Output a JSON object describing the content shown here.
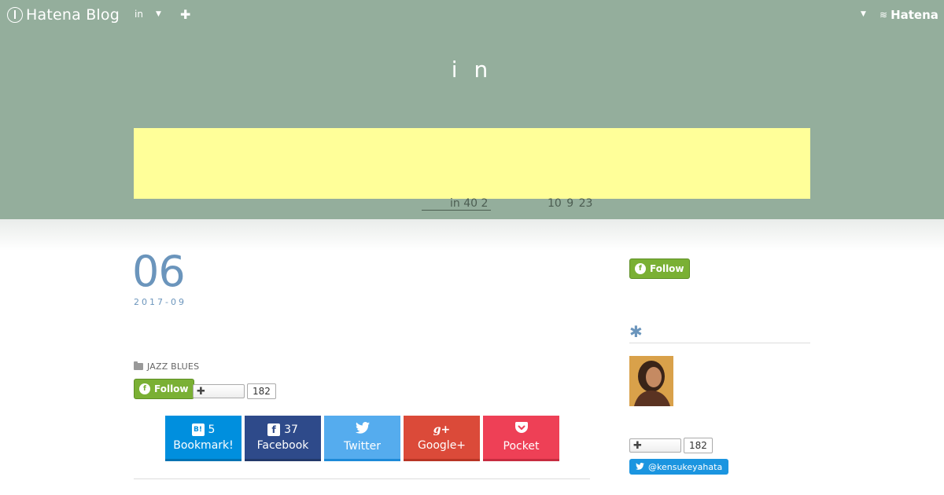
{
  "topbar": {
    "logo_text": "Hatena Blog",
    "blog_selector": "in",
    "brand": "Hatena"
  },
  "blog": {
    "title": "i n",
    "banner_note_left": "in  40 2",
    "banner_note_right": "10  9  23"
  },
  "post": {
    "day": "06",
    "year_month": "2017-09",
    "category": "JAZZ BLUES"
  },
  "follow": {
    "label": "Follow"
  },
  "bookmark_counter": {
    "count": "182"
  },
  "share": [
    {
      "name": "Bookmark!",
      "count": "5",
      "icon": "B!",
      "color": "#008fde"
    },
    {
      "name": "Facebook",
      "count": "37",
      "icon": "f",
      "color": "#2e4a8a"
    },
    {
      "name": "Twitter",
      "count": "",
      "icon": "twitter-bird",
      "color": "#55acee"
    },
    {
      "name": "Google+",
      "count": "",
      "icon": "g+",
      "color": "#db4a39"
    },
    {
      "name": "Pocket",
      "count": "",
      "icon": "pocket",
      "color": "#ee4056"
    }
  ],
  "sidebar": {
    "follow_label": "Follow",
    "heading_symbol": "✱",
    "bookmark_count": "182",
    "twitter_handle": "@kensukeyahata"
  },
  "colors": {
    "header_bg": "#94ae9c",
    "banner_bg": "#ffff99",
    "accent_blue": "#6b95bc",
    "follow_green": "#7ab034"
  }
}
